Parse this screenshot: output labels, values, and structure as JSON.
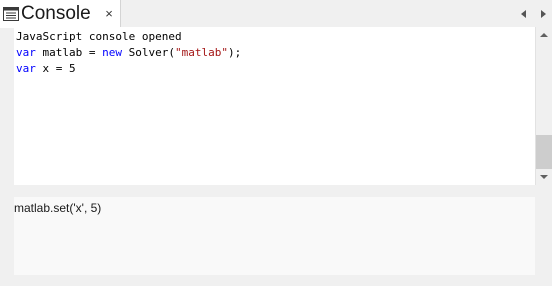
{
  "tab": {
    "title": "Console",
    "close_glyph": "×",
    "icon": "console-window-icon"
  },
  "navigation": {
    "left_icon": "triangle-left-icon",
    "right_icon": "triangle-right-icon"
  },
  "output": {
    "lines": [
      {
        "segments": [
          {
            "text": "JavaScript console opened",
            "kind": "plain"
          }
        ]
      },
      {
        "segments": [
          {
            "text": "var",
            "kind": "keyword"
          },
          {
            "text": " matlab = ",
            "kind": "plain"
          },
          {
            "text": "new",
            "kind": "keyword"
          },
          {
            "text": " Solver(",
            "kind": "plain"
          },
          {
            "text": "\"matlab\"",
            "kind": "string"
          },
          {
            "text": ");",
            "kind": "plain"
          }
        ]
      },
      {
        "segments": [
          {
            "text": "var",
            "kind": "keyword"
          },
          {
            "text": " x = 5",
            "kind": "plain"
          }
        ]
      }
    ]
  },
  "scrollbar": {
    "up_icon": "scroll-up-arrow-icon",
    "down_icon": "scroll-down-arrow-icon"
  },
  "input": {
    "value": "matlab.set('x', 5)"
  },
  "colors": {
    "keyword": "#0000ff",
    "string": "#a31515",
    "plain": "#000000",
    "background": "#f0f0f0"
  }
}
